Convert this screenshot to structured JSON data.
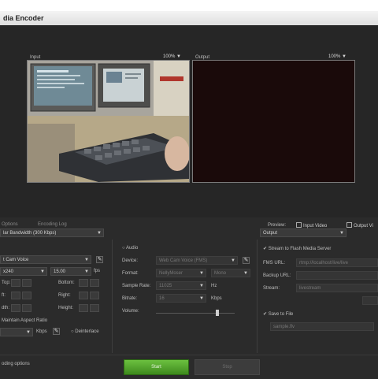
{
  "window": {
    "title": "dia Encoder"
  },
  "preview": {
    "input_label": "Input",
    "input_zoom": "100%",
    "output_label": "Output",
    "output_zoom": "100%",
    "caret": "▼"
  },
  "tabs": {
    "options": "Options",
    "encoding_log": "Encoding Log",
    "preview_label": "Preview:",
    "input_video": "Input Video",
    "output_video": "Output Vi"
  },
  "left": {
    "preset": "lar Bandwidth (300 Kbps)",
    "device": "t Cam Voice",
    "frame_size": "x240",
    "frame_rate": "15.00",
    "fps_unit": "fps",
    "crop_top": "Top:",
    "crop_bottom": "Bottom:",
    "crop_left": "ft:",
    "crop_right": "Right:",
    "crop_width": "dth:",
    "crop_height": "Height:",
    "aspect_text": "Maintain Aspect Ratio",
    "kbps": "Kbps",
    "deinterlace": "Deinterlace"
  },
  "audio": {
    "label": "Audio",
    "device_label": "Device:",
    "device_value": "Web Cam Voice (FMS)",
    "format_label": "Format:",
    "format_value": "NellyMoser",
    "channels_value": "Mono",
    "sample_rate_label": "Sample Rate:",
    "sample_rate_value": "11025",
    "sample_rate_unit": "Hz",
    "bitrate_label": "Bitrate:",
    "bitrate_value": "16",
    "bitrate_unit": "Kbps",
    "volume_label": "Volume:",
    "volume_level": 0.78
  },
  "output": {
    "format": "Output",
    "stream_label": "Stream to Flash Media Server",
    "fms_url_label": "FMS URL:",
    "fms_url_value": "rtmp://localhost/live/live",
    "backup_label": "Backup URL:",
    "stream_name_label": "Stream:",
    "stream_name_value": "livestream",
    "save_label": "Save to File",
    "file_value": "sample.flv"
  },
  "bottom": {
    "encoding_options": "oding options",
    "start": "Start",
    "stop": "Stop"
  }
}
